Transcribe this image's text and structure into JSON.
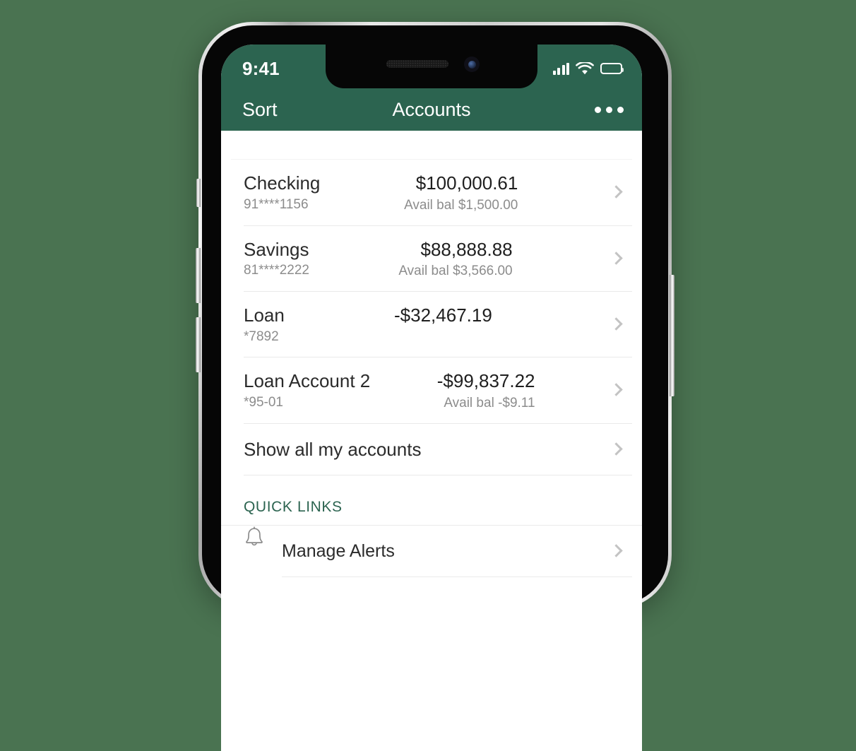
{
  "status_bar": {
    "time": "9:41",
    "signal_icon": "cellular-signal-icon",
    "wifi_icon": "wifi-icon",
    "battery_icon": "battery-full-icon"
  },
  "nav_bar": {
    "left_action": "Sort",
    "title": "Accounts",
    "more_icon": "more-options-icon"
  },
  "theme": {
    "header_green": "#2c6450",
    "page_background": "#4a7351",
    "screen_background": "#ffffff",
    "separator": "#eaeaea",
    "secondary_text": "#8c8c8c"
  },
  "accounts": [
    {
      "name": "Checking",
      "number": "91****1156",
      "balance": "$100,000.61",
      "available": "Avail bal $1,500.00",
      "chevron_icon": "chevron-right-icon"
    },
    {
      "name": "Savings",
      "number": "81****2222",
      "balance": "$88,888.88",
      "available": "Avail bal $3,566.00",
      "chevron_icon": "chevron-right-icon"
    },
    {
      "name": "Loan",
      "number": "*7892",
      "balance": "-$32,467.19",
      "available": "",
      "chevron_icon": "chevron-right-icon"
    },
    {
      "name": "Loan Account 2",
      "number": "*95-01",
      "balance": "-$99,837.22",
      "available": "Avail bal -$9.11",
      "chevron_icon": "chevron-right-icon"
    }
  ],
  "show_all": {
    "label": "Show all my accounts",
    "chevron_icon": "chevron-right-icon"
  },
  "quick_links": {
    "header": "QUICK LINKS",
    "items": [
      {
        "label": "Manage Alerts",
        "icon": "bell-icon",
        "chevron_icon": "chevron-right-icon"
      }
    ]
  }
}
